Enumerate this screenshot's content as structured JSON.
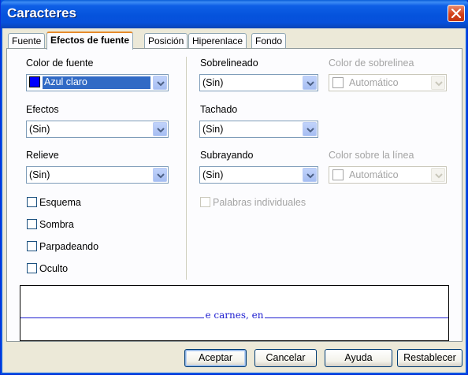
{
  "window": {
    "title": "Caracteres"
  },
  "tabs": [
    {
      "label": "Fuente"
    },
    {
      "label": "Efectos de fuente",
      "active": true
    },
    {
      "label": "Posición"
    },
    {
      "label": "Hiperenlace"
    },
    {
      "label": "Fondo"
    }
  ],
  "left": {
    "font_color": {
      "label": "Color de fuente",
      "value": "Azul claro",
      "swatch": "#0000ff"
    },
    "effects": {
      "label": "Efectos",
      "value": "(Sin)"
    },
    "relief": {
      "label": "Relieve",
      "value": "(Sin)"
    },
    "checks": [
      {
        "label": "Esquema",
        "checked": false
      },
      {
        "label": "Sombra",
        "checked": false
      },
      {
        "label": "Parpadeando",
        "checked": false
      },
      {
        "label": "Oculto",
        "checked": false
      }
    ]
  },
  "right": {
    "overline": {
      "label": "Sobrelineado",
      "value": "(Sin)"
    },
    "overline_color": {
      "label": "Color de sobrelinea",
      "value": "Automático",
      "disabled": true
    },
    "strikethrough": {
      "label": "Tachado",
      "value": "(Sin)"
    },
    "underline": {
      "label": "Subrayando",
      "value": "(Sin)"
    },
    "underline_color": {
      "label": "Color sobre la línea",
      "value": "Automático",
      "disabled": true
    },
    "individual_words": {
      "label": "Palabras individuales",
      "checked": false,
      "disabled": true
    }
  },
  "preview": {
    "text": "e carnes, en"
  },
  "buttons": {
    "ok": "Aceptar",
    "cancel": "Cancelar",
    "help": "Ayuda",
    "reset": "Restablecer"
  },
  "colors": {
    "titlebar": "#0553dc",
    "accent_tab": "#e68b2c",
    "selection": "#316ac5"
  }
}
